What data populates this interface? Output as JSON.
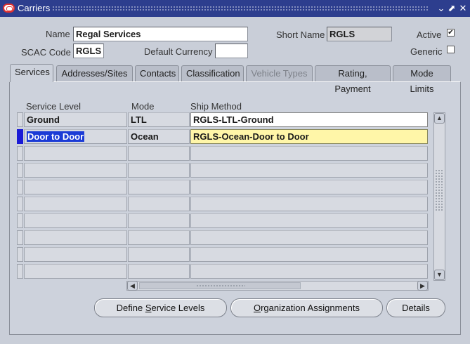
{
  "window": {
    "title": "Carriers",
    "minimize_glyph": "⌄",
    "restore_glyph": "⬈",
    "close_glyph": "✕",
    "icon": "oracle-app-icon"
  },
  "header": {
    "name_label": "Name",
    "name_value": "Regal Services",
    "short_name_label": "Short Name",
    "short_name_value": "RGLS",
    "active_label": "Active",
    "active_checked": true,
    "active_glyph": "✔",
    "scac_label": "SCAC Code",
    "scac_value": "RGLS",
    "currency_label": "Default Currency",
    "currency_value": "",
    "generic_label": "Generic",
    "generic_checked": false
  },
  "tabs": [
    {
      "label": "Services",
      "active": true,
      "disabled": false
    },
    {
      "label": "Addresses/Sites",
      "active": false,
      "disabled": false
    },
    {
      "label": "Contacts",
      "active": false,
      "disabled": false
    },
    {
      "label": "Classification",
      "active": false,
      "disabled": false
    },
    {
      "label": "Vehicle Types",
      "active": false,
      "disabled": true
    },
    {
      "label": "Rating, Payment",
      "active": false,
      "disabled": false
    },
    {
      "label": "Mode Limits",
      "active": false,
      "disabled": false
    }
  ],
  "grid": {
    "columns": [
      "Service Level",
      "Mode",
      "Ship Method"
    ],
    "rows": [
      {
        "service_level": "Ground",
        "mode": "LTL",
        "ship_method": "RGLS-LTL-Ground"
      },
      {
        "service_level": "Door to Door",
        "mode": "Ocean",
        "ship_method": "RGLS-Ocean-Door to Door"
      }
    ],
    "current_row": 1
  },
  "buttons": {
    "define_service_levels": {
      "before": "Define ",
      "mnemonic": "S",
      "after": "ervice Levels"
    },
    "organization_assignments": {
      "before": "",
      "mnemonic": "O",
      "after": "rganization Assignments"
    },
    "details": {
      "before": "Details",
      "mnemonic": "",
      "after": ""
    }
  },
  "colors": {
    "titlebar": "#2d3e8e",
    "current_row": "#fff6a8",
    "selection": "#1b3bd6"
  }
}
